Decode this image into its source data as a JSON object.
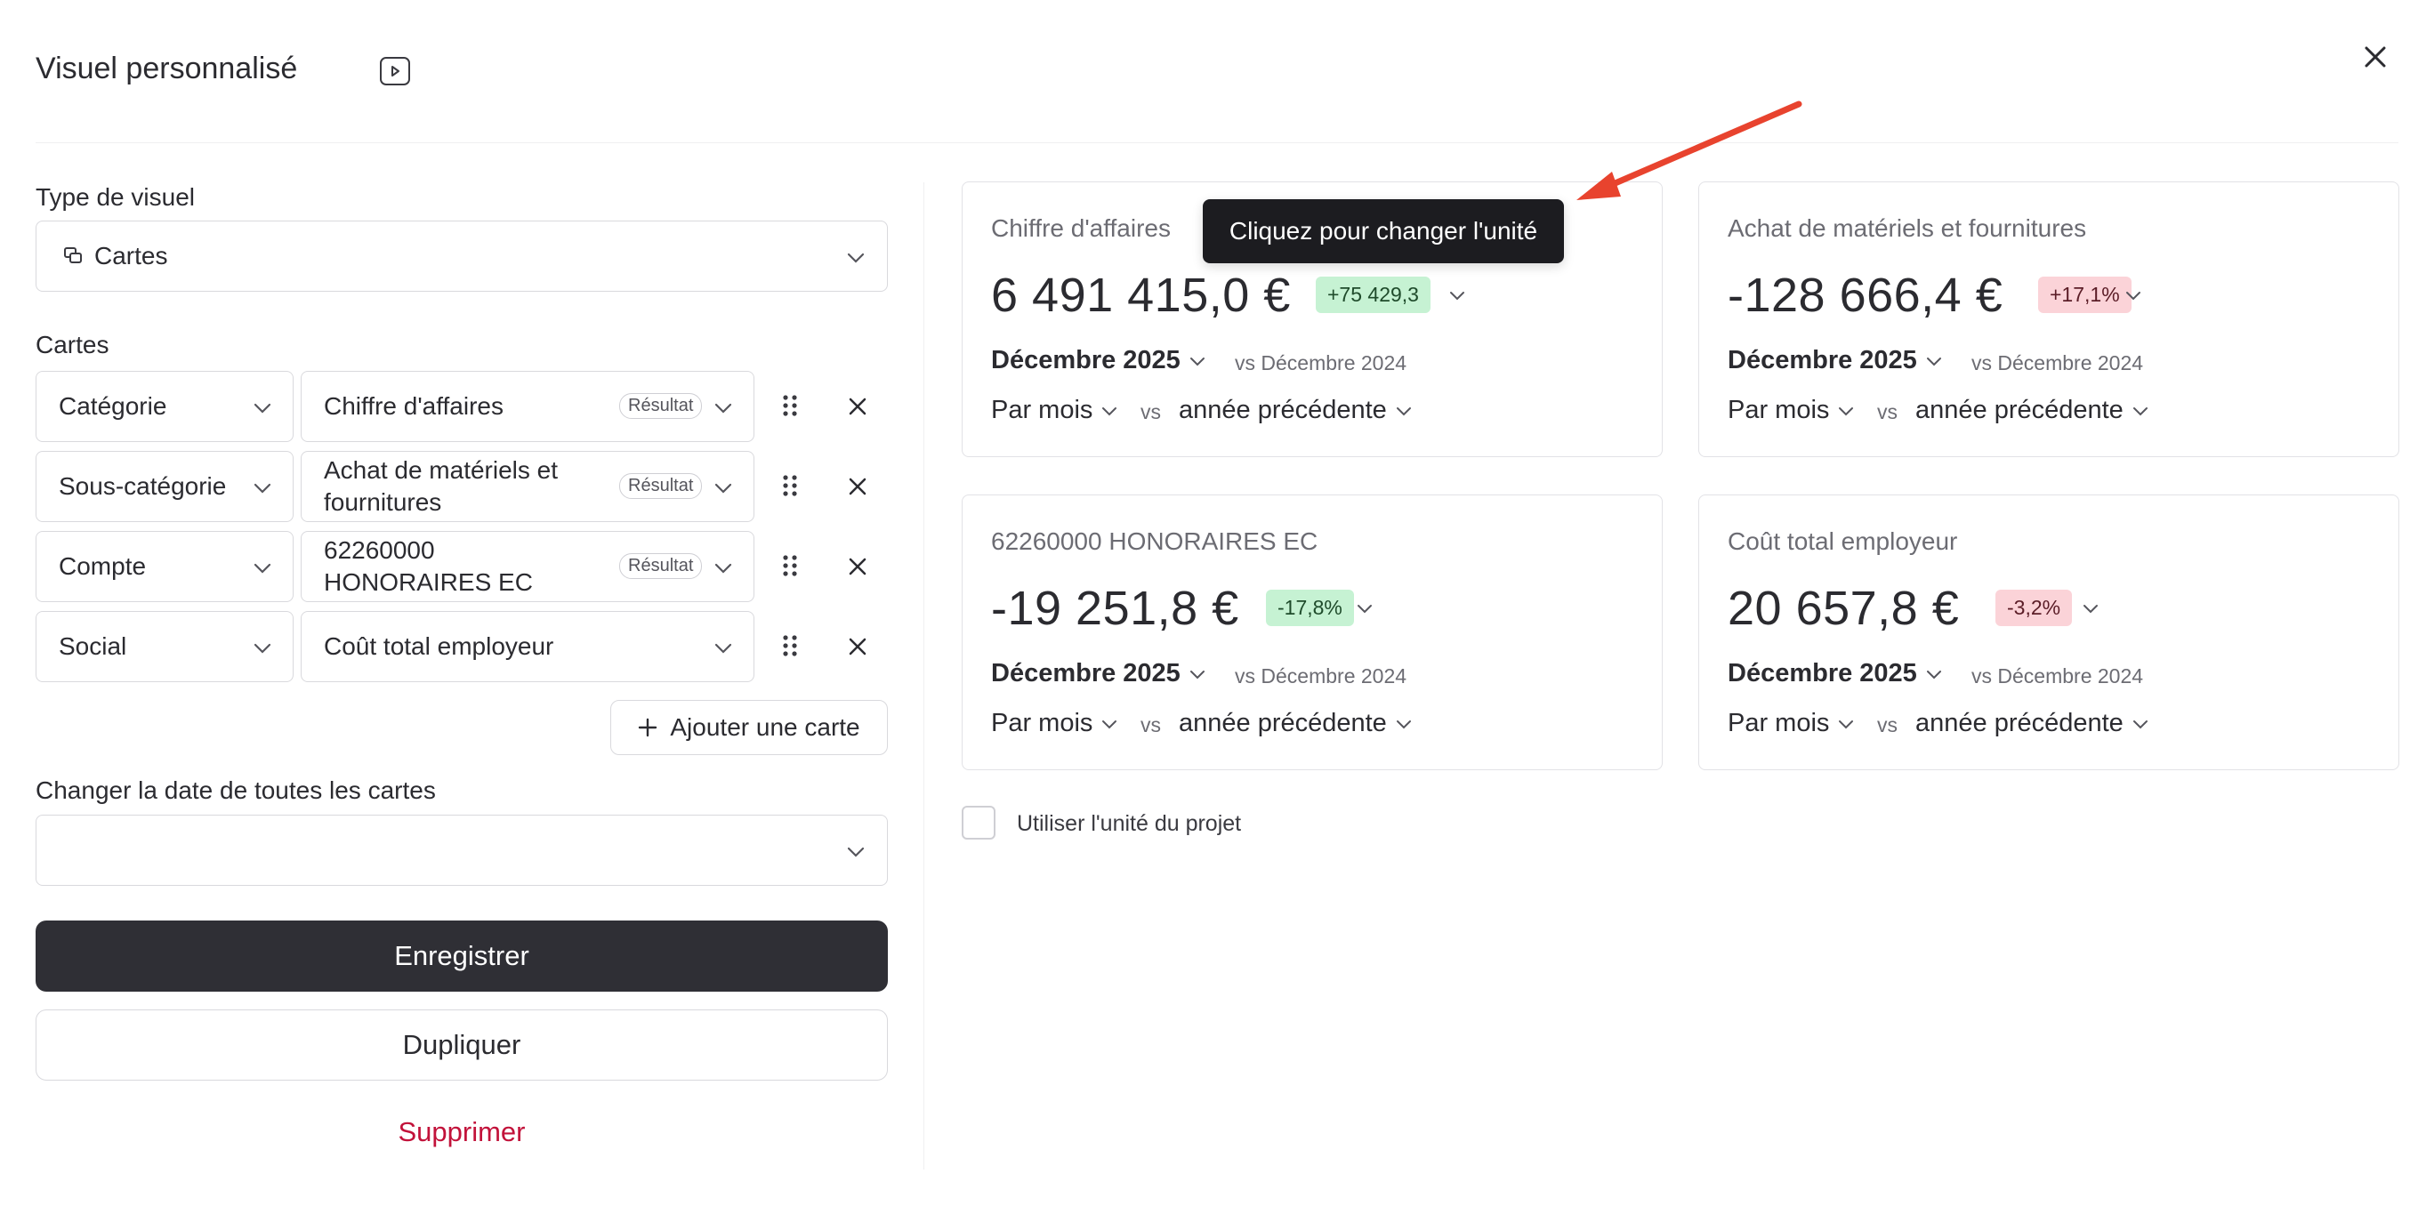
{
  "header": {
    "title": "Visuel personnalisé"
  },
  "form": {
    "visual_type_label": "Type de visuel",
    "visual_type_value": "Cartes",
    "cards_label": "Cartes",
    "rows": [
      {
        "type": "Catégorie",
        "item_line1": "Chiffre d'affaires",
        "item_line2": "",
        "badge": "Résultat"
      },
      {
        "type": "Sous-catégorie",
        "item_line1": "Achat de matériels et",
        "item_line2": "fournitures",
        "badge": "Résultat"
      },
      {
        "type": "Compte",
        "item_line1": "62260000",
        "item_line2": "HONORAIRES EC",
        "badge": "Résultat"
      },
      {
        "type": "Social",
        "item_line1": "Coût total employeur",
        "item_line2": "",
        "badge": ""
      }
    ],
    "add_card_label": "Ajouter une carte",
    "change_date_label": "Changer la date de toutes les cartes",
    "change_date_value": "",
    "save_label": "Enregistrer",
    "duplicate_label": "Dupliquer",
    "delete_label": "Supprimer"
  },
  "cards": [
    {
      "title": "Chiffre d'affaires",
      "value": "6 491 415,0 €",
      "delta": "+75 429,3",
      "delta_sign": "positive",
      "period": "Décembre 2025",
      "vs_period": "vs Décembre 2024",
      "frequency": "Par mois",
      "vs": "vs",
      "comparison": "année précédente"
    },
    {
      "title": "Achat de matériels et fournitures",
      "value": "-128 666,4 €",
      "delta": "+17,1%",
      "delta_sign": "negative",
      "period": "Décembre 2025",
      "vs_period": "vs Décembre 2024",
      "frequency": "Par mois",
      "vs": "vs",
      "comparison": "année précédente"
    },
    {
      "title": "62260000 HONORAIRES EC",
      "value": "-19 251,8 €",
      "delta": "-17,8%",
      "delta_sign": "positive",
      "period": "Décembre 2025",
      "vs_period": "vs Décembre 2024",
      "frequency": "Par mois",
      "vs": "vs",
      "comparison": "année précédente"
    },
    {
      "title": "Coût total employeur",
      "value": "20 657,8 €",
      "delta": "-3,2%",
      "delta_sign": "negative",
      "period": "Décembre 2025",
      "vs_period": "vs Décembre 2024",
      "frequency": "Par mois",
      "vs": "vs",
      "comparison": "année précédente"
    }
  ],
  "tooltip": "Cliquez pour changer l'unité",
  "project_unit_label": "Utiliser l'unité du projet",
  "colors": {
    "primary_button": "#2f2f35",
    "delete_text": "#c2123a",
    "positive_pill": "#c6f2d3",
    "negative_pill": "#fbd3d8",
    "annotation_arrow": "#e8432e"
  },
  "icons": [
    "play-icon",
    "close-icon",
    "cards-icon",
    "chevron-down-icon",
    "drag-handle-icon",
    "plus-icon",
    "annotation-arrow"
  ]
}
